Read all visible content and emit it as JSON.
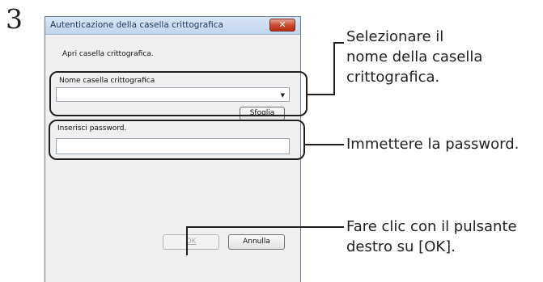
{
  "step_number": "3",
  "dialog": {
    "title": "Autenticazione della casella crittografica",
    "close_label": "✕",
    "intro_text": "Apri casella crittografica.",
    "box_name_label": "Nome casella crittografica",
    "box_name_value": "",
    "browse_button": "Sfoglia",
    "password_label": "Inserisci password.",
    "password_value": "",
    "ok_button": "OK",
    "cancel_button": "Annulla"
  },
  "callouts": {
    "select_line1": "Selezionare il",
    "select_line2": "nome della casella",
    "select_line3": "crittografica.",
    "password": "Immettere la password.",
    "ok_line1": "Fare clic con il pulsante",
    "ok_line2": "destro su [OK]."
  }
}
